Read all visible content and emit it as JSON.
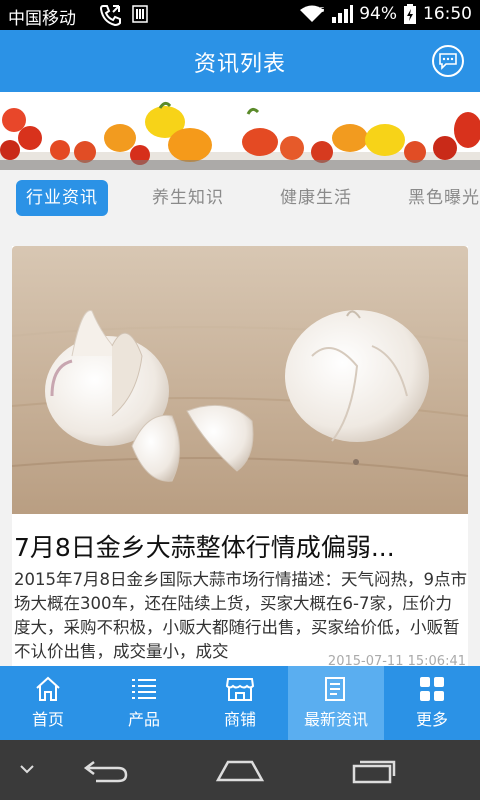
{
  "status_bar": {
    "carrier": "中国移动",
    "battery": "94%",
    "time": "16:50",
    "icons": [
      "call-icon",
      "sim-icon",
      "wifi-icon",
      "signal-icon",
      "battery-icon"
    ]
  },
  "header": {
    "title": "资讯列表",
    "chat_icon": "chat-bubble-icon"
  },
  "tabs": [
    {
      "label": "行业资讯",
      "active": true
    },
    {
      "label": "养生知识",
      "active": false
    },
    {
      "label": "健康生活",
      "active": false
    },
    {
      "label": "黑色曝光",
      "active": false
    }
  ],
  "article": {
    "title": "7月8日金乡大蒜整体行情成偏弱...",
    "description": "2015年7月8日金乡国际大蒜市场行情描述：天气闷热，9点市场大概在300车，还在陆续上货，买家大概在6-7家，压价力度大，采购不积极，小贩大都随行出售，买家给价低，小贩暂不认价出售，成交量小，成交",
    "date": "2015-07-11 15:06:41"
  },
  "bottom_nav": [
    {
      "label": "首页",
      "icon": "home-icon",
      "active": false
    },
    {
      "label": "产品",
      "icon": "list-icon",
      "active": false
    },
    {
      "label": "商铺",
      "icon": "shop-icon",
      "active": false
    },
    {
      "label": "最新资讯",
      "icon": "news-icon",
      "active": true
    },
    {
      "label": "更多",
      "icon": "grid-icon",
      "active": false
    }
  ],
  "colors": {
    "primary": "#2b92e6",
    "active_nav": "#5aaef0",
    "tab_bg": "#f2f2f2"
  }
}
